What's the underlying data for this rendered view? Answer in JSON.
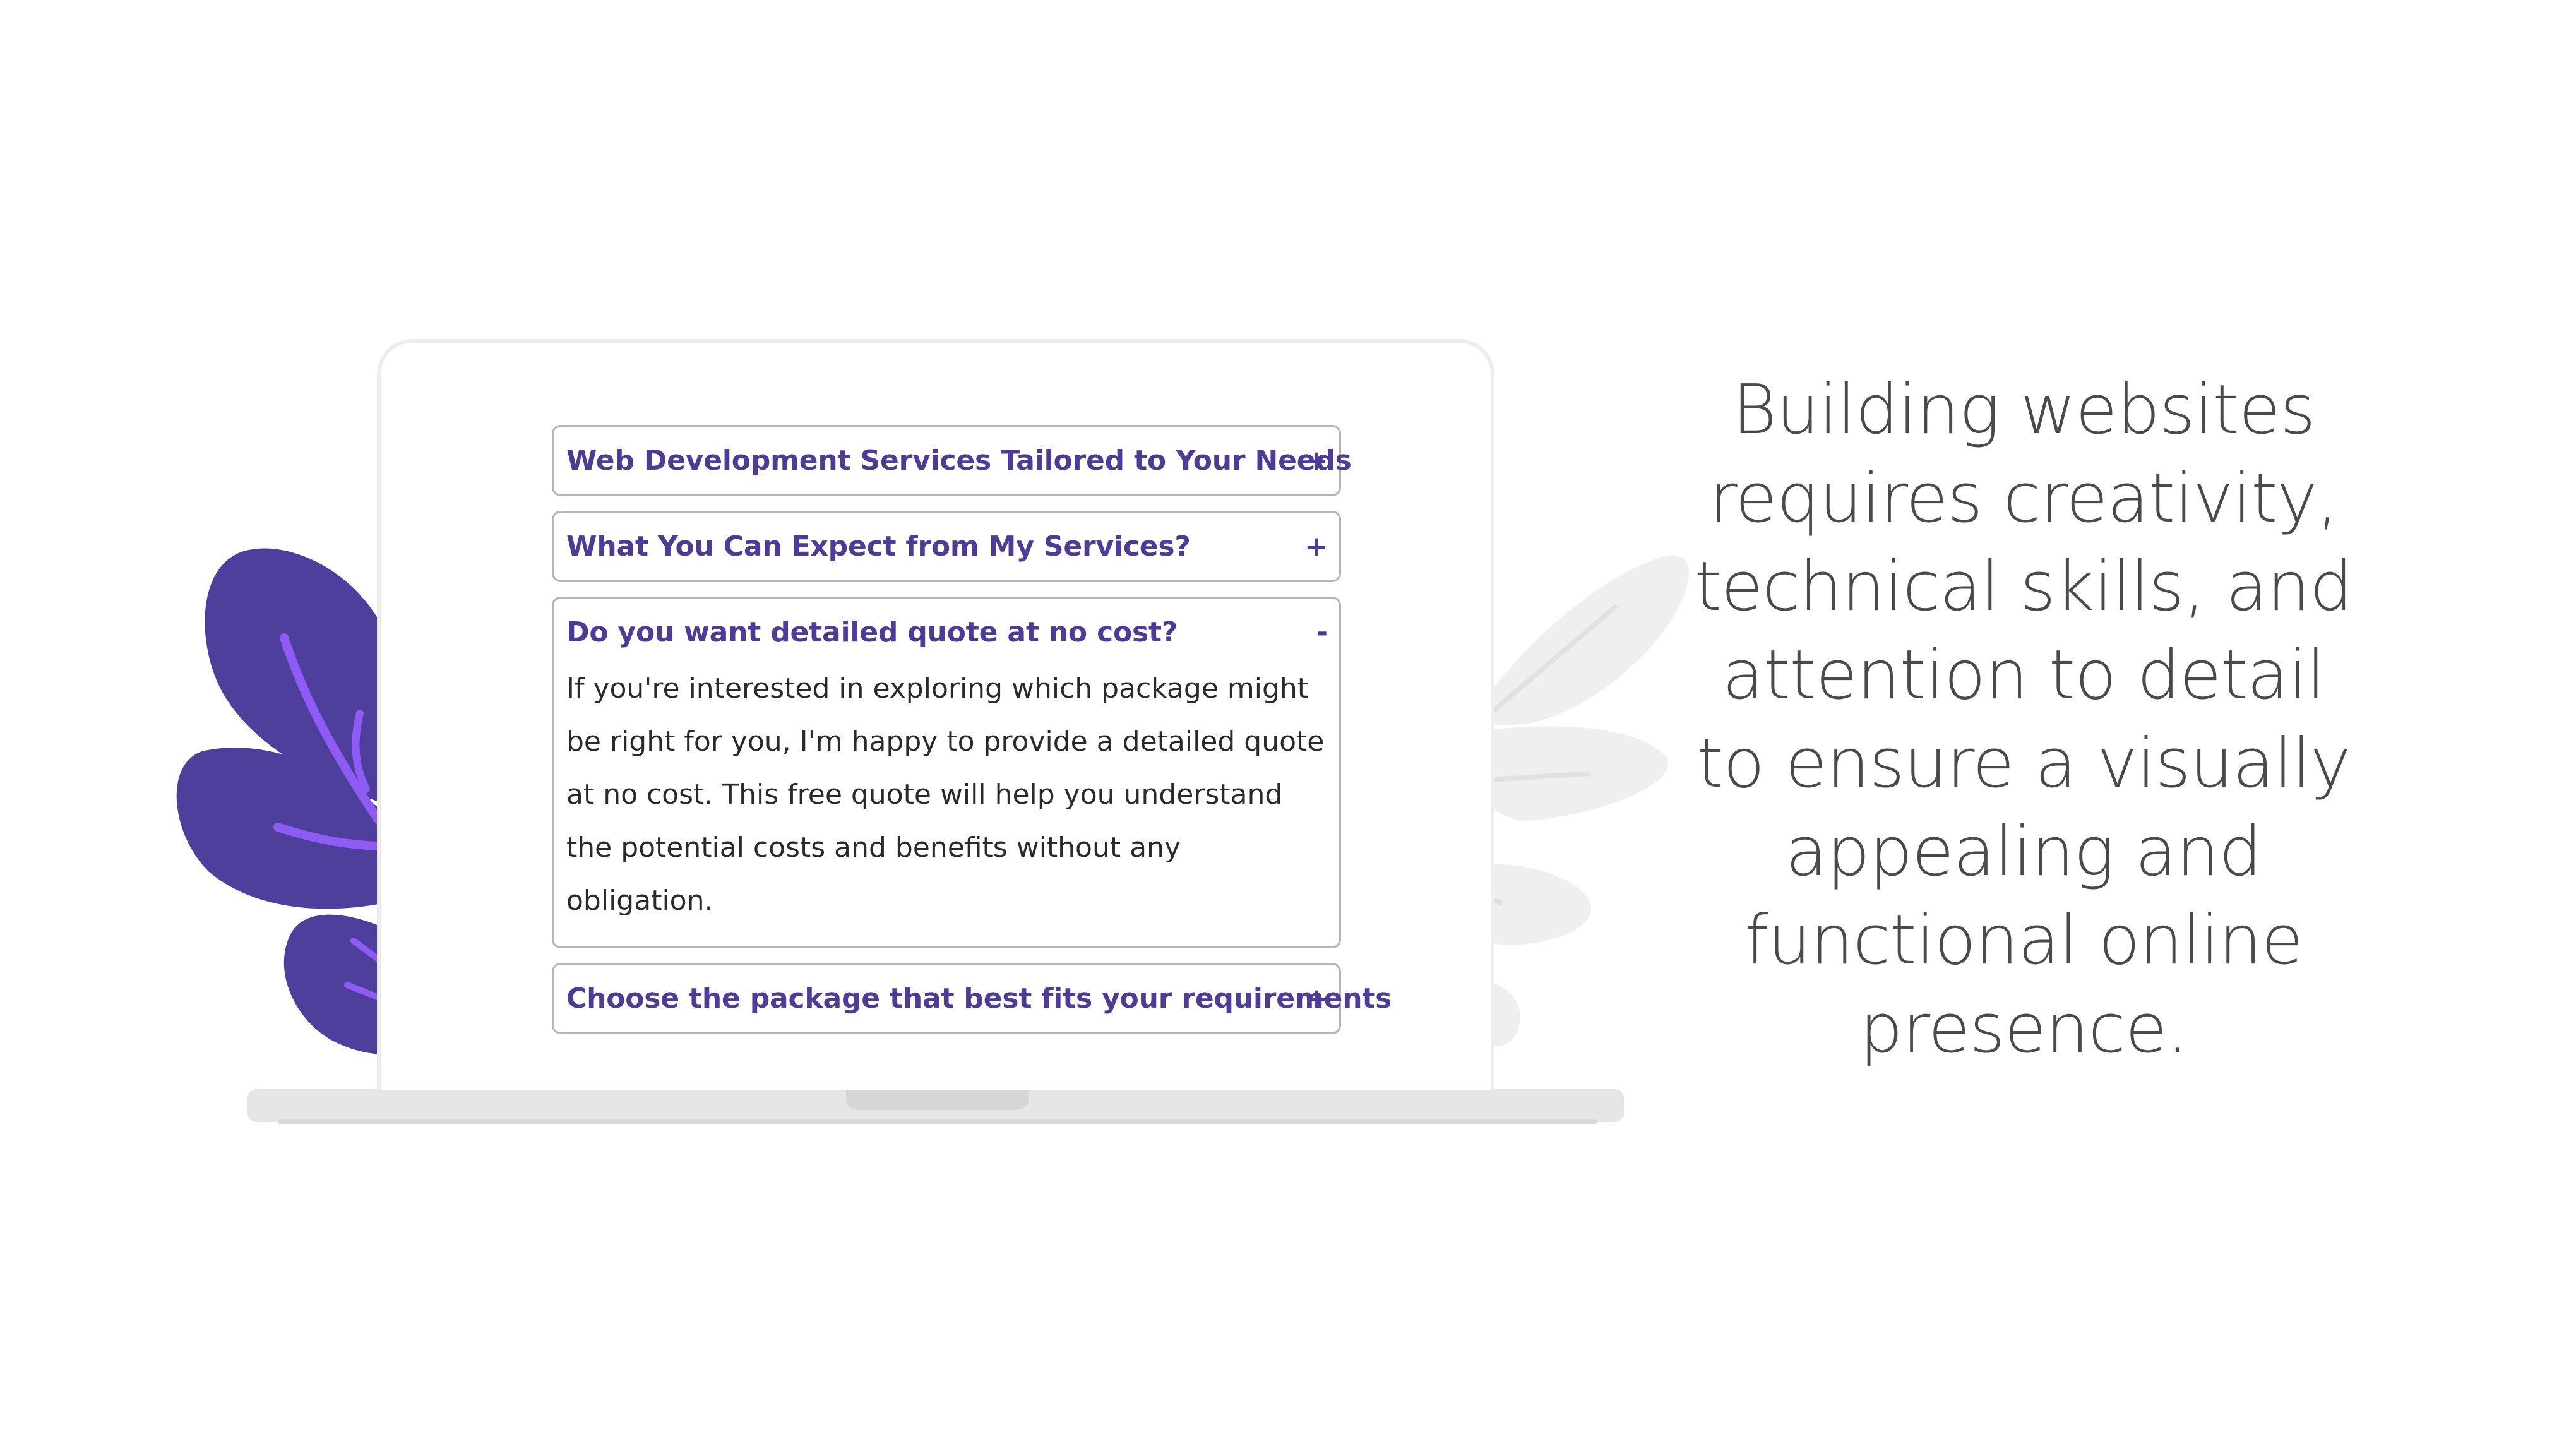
{
  "faq": {
    "items": [
      {
        "title": "Web Development Services Tailored to Your Needs",
        "toggle": "+",
        "expanded": false
      },
      {
        "title": "What You Can Expect from My Services?",
        "toggle": "+",
        "expanded": false
      },
      {
        "title": "Do you want detailed quote at no cost?",
        "toggle": "-",
        "expanded": true,
        "body": "If you're interested in exploring which package might be right for you, I'm happy to provide a detailed quote at no cost. This free quote will help you understand the potential costs and benefits without any obligation."
      },
      {
        "title": "Choose the package that best fits your requirements",
        "toggle": "+",
        "expanded": false
      }
    ]
  },
  "tagline": "Building websites requires creativity, technical skills, and attention to detail to ensure a visually appealing and functional online presence.",
  "colors": {
    "accent": "#4d3b96",
    "leaf_dark": "#4f3f9c",
    "leaf_vein": "#8f5bf5",
    "leaf_gray": "#efefef",
    "laptop_base": "#e6e6e6"
  },
  "icons": [
    "plus-icon",
    "minus-icon",
    "leaf-illustration"
  ]
}
